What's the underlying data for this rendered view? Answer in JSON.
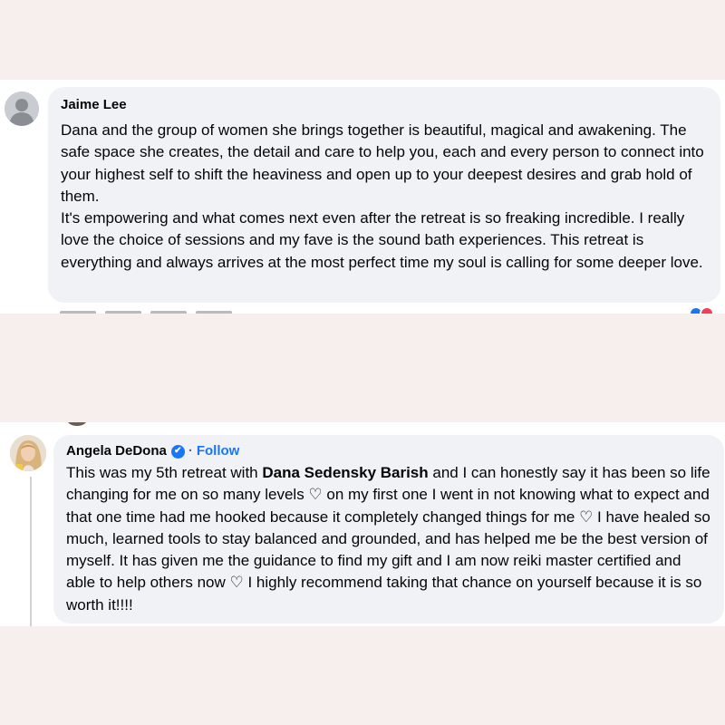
{
  "comments": [
    {
      "author": "Jaime Lee",
      "text": "Dana and the group of women she brings together is beautiful, magical and awakening. The safe space she creates, the detail and care to help you, each and every person to connect into your highest self to shift the heaviness and open up to your deepest desires and grab hold of them.\nIt's empowering and what comes next even after the retreat is so freaking incredible. I really love the choice of sessions and my fave is the sound bath experiences. This retreat is everything and always arrives at the most perfect time my soul is calling for some deeper love."
    },
    {
      "author": "Angela DeDona",
      "verified_icon": "✔",
      "separator": "·",
      "follow_label": "Follow",
      "text_before": "This was my 5th retreat with ",
      "mention": "Dana Sedensky Barish",
      "text_after": " and I can honestly say it has been so life changing for me on so many levels ♡ on my first one I went in not knowing what to expect and that one time had me hooked because it completely changed things for me ♡ I have healed so much, learned tools to stay balanced and grounded, and has helped me be the best version of myself. It has given me the guidance to find my gift and I am now reiki master certified and able to help others now ♡ I highly recommend taking that chance on yourself because it is so worth it!!!!"
    }
  ],
  "colors": {
    "page_background": "#f7efee",
    "bubble": "#f0f2f5",
    "link": "#1877f2",
    "like": "#1877f2",
    "love": "#f33e58"
  }
}
